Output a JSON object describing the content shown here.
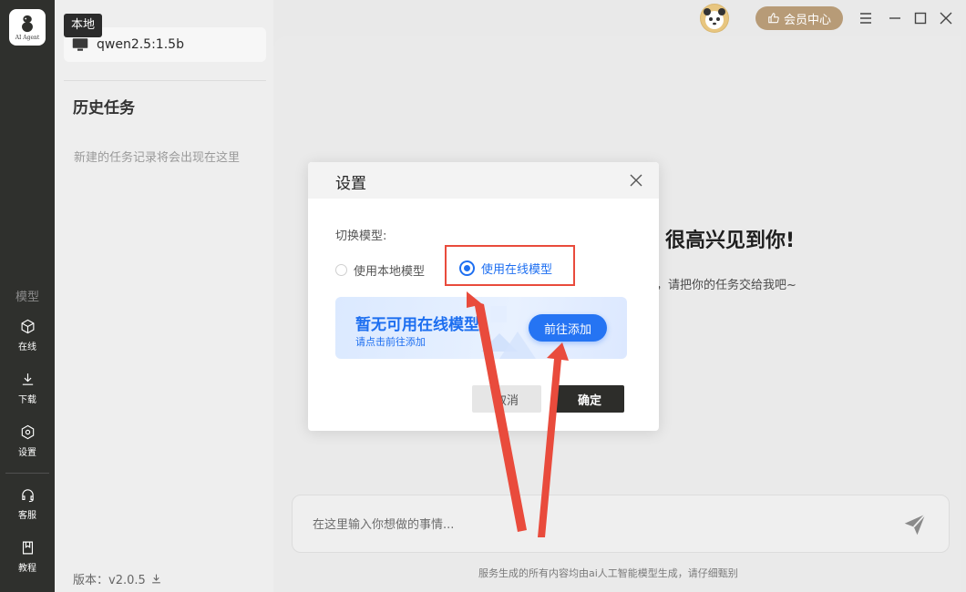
{
  "rail": {
    "logo_text": "AI Agent",
    "section_label": "模型",
    "items": [
      {
        "label": "在线",
        "icon": "cube-icon"
      },
      {
        "label": "下载",
        "icon": "download-icon"
      },
      {
        "label": "设置",
        "icon": "gear-icon"
      },
      {
        "label": "客服",
        "icon": "headset-icon"
      },
      {
        "label": "教程",
        "icon": "book-icon"
      }
    ]
  },
  "panel": {
    "tooltip": "本地",
    "model_name": "qwen2.5:1.5b",
    "history_title": "历史任务",
    "history_empty": "新建的任务记录将会出现在这里",
    "version": "版本：v2.0.5"
  },
  "topbar": {
    "vip_label": "会员中心"
  },
  "main": {
    "greeting": "很高兴见到你!",
    "greeting_sub": "容，请把你的任务交给我吧~",
    "input_placeholder": "在这里输入你想做的事情...",
    "footer_note": "服务生成的所有内容均由ai人工智能模型生成，请仔细甄别"
  },
  "modal": {
    "title": "设置",
    "switch_label": "切换模型:",
    "option_local": "使用本地模型",
    "option_online": "使用在线模型",
    "selected": "online",
    "banner_title": "暂无可用在线模型",
    "banner_sub": "请点击前往添加",
    "banner_button": "前往添加",
    "cancel_label": "取消",
    "ok_label": "确定"
  },
  "colors": {
    "accent": "#1e6ff1",
    "rail_bg": "#2f302d",
    "vip_bg": "#b79b77",
    "annotation_red": "#e94b3c"
  }
}
